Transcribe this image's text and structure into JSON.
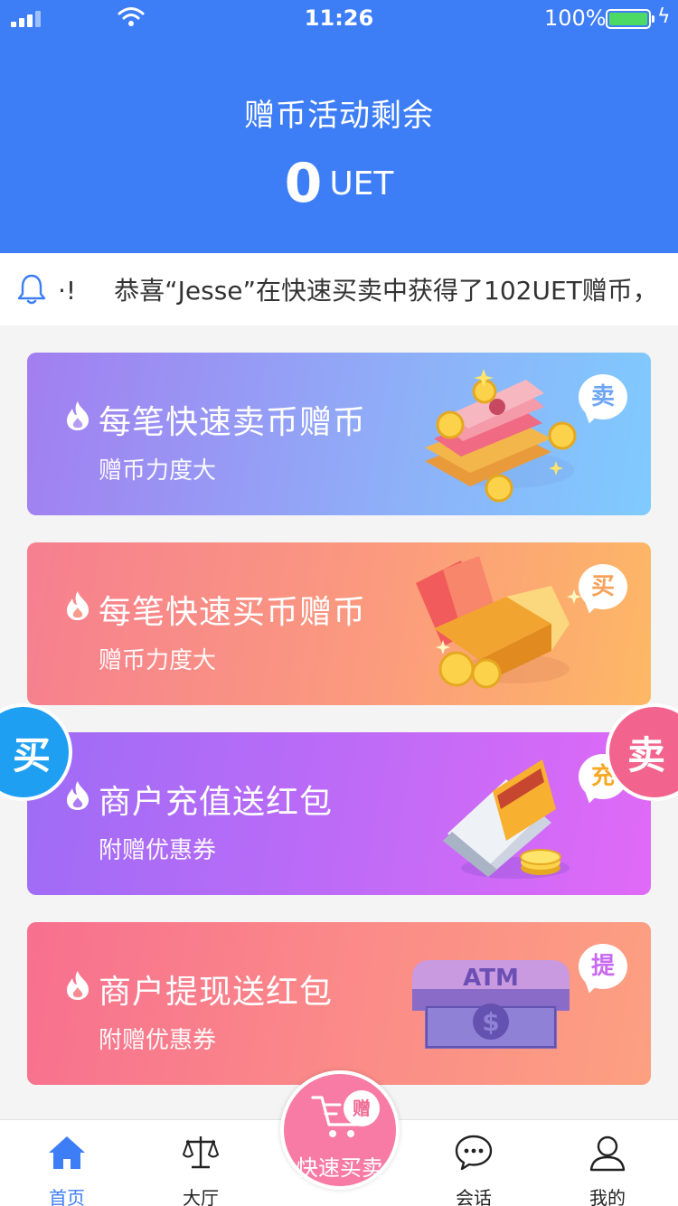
{
  "status_bar": {
    "time": "11:26",
    "battery": "100%"
  },
  "header": {
    "title": "赠币活动剩余",
    "amount": "0",
    "unit": "UET"
  },
  "notice": {
    "prefix": "·!",
    "message": "恭喜“Jesse”在快速买卖中获得了102UET赠币，"
  },
  "cards": [
    {
      "title": "每笔快速卖币赠币",
      "subtitle": "赠币力度大",
      "badge": "卖",
      "badge_color": "#6ea6f5",
      "gradient": [
        "#a27ef0",
        "#7fc7ff"
      ],
      "icon": "money-stack-illustration"
    },
    {
      "title": "每笔快速买币赠币",
      "subtitle": "赠币力度大",
      "badge": "买",
      "badge_color": "#f7a25a",
      "gradient": [
        "#f67f90",
        "#fdb865"
      ],
      "icon": "gold-box-illustration"
    },
    {
      "title": "商户充值送红包",
      "subtitle": "附赠优惠券",
      "badge": "充",
      "badge_color": "#f7a825",
      "gradient": [
        "#9e6cf6",
        "#e06af7"
      ],
      "icon": "wallet-card-illustration"
    },
    {
      "title": "商户提现送红包",
      "subtitle": "附赠优惠券",
      "badge": "提",
      "badge_color": "#c86af0",
      "gradient": [
        "#f7708f",
        "#fca081"
      ],
      "icon": "atm-illustration"
    }
  ],
  "side_buttons": {
    "buy": "买",
    "sell": "卖",
    "buy_color": "#1e9ff2",
    "sell_color": "#f2648d"
  },
  "tabbar": {
    "items": [
      {
        "label": "首页",
        "icon": "home-icon",
        "active": true
      },
      {
        "label": "大厅",
        "icon": "scale-icon",
        "active": false
      },
      {
        "label": "会话",
        "icon": "chat-icon",
        "active": false
      },
      {
        "label": "我的",
        "icon": "user-icon",
        "active": false
      }
    ],
    "center": {
      "label": "快速买卖",
      "badge": "赠",
      "icon": "cart-icon"
    }
  },
  "colors": {
    "primary": "#3d7ef6",
    "accent_pink": "#f77ba4"
  }
}
